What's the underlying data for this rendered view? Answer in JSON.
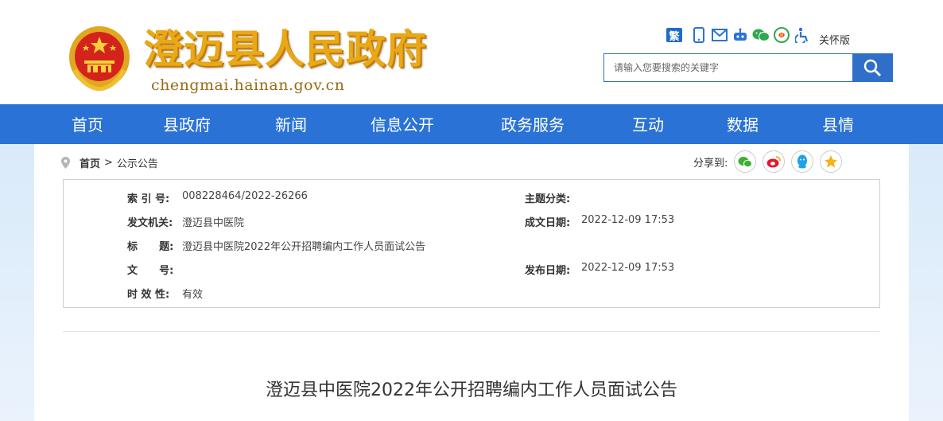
{
  "header": {
    "site_title": "澄迈县人民政府",
    "site_domain": "chengmai.hainan.gov.cn",
    "tools": {
      "traditional_label": "繁",
      "icons": [
        "mobile-icon",
        "mail-icon",
        "robot-icon",
        "wechat-icon",
        "app-icon",
        "accessibility-icon"
      ],
      "care_mode_label": "关怀版"
    },
    "search": {
      "placeholder": "请输入您要搜索的关键字"
    }
  },
  "nav": {
    "items": [
      {
        "label": "首页"
      },
      {
        "label": "县政府"
      },
      {
        "label": "新闻"
      },
      {
        "label": "信息公开"
      },
      {
        "label": "政务服务"
      },
      {
        "label": "互动"
      },
      {
        "label": "数据"
      },
      {
        "label": "县情"
      }
    ]
  },
  "breadcrumb": {
    "home": "首页",
    "separator": ">",
    "current": "公示公告"
  },
  "share": {
    "label": "分享到:",
    "icons": [
      "wechat-icon",
      "weibo-icon",
      "qq-icon",
      "qzone-icon"
    ]
  },
  "meta": {
    "index_label": "索 引 号:",
    "index_value": "008228464/2022-26266",
    "topic_label": "主题分类:",
    "topic_value": "",
    "issuer_label": "发文机关:",
    "issuer_value": "澄迈县中医院",
    "created_label": "成文日期:",
    "created_value": "2022-12-09 17:53",
    "title_label": "标      题:",
    "title_value": "澄迈县中医院2022年公开招聘编内工作人员面试公告",
    "docno_label": "文      号:",
    "docno_value": "",
    "published_label": "发布日期:",
    "published_value": "2022-12-09 17:53",
    "validity_label": "时 效 性:",
    "validity_value": "有效"
  },
  "article": {
    "title": "澄迈县中医院2022年公开招聘编内工作人员面试公告"
  },
  "colors": {
    "nav_blue": "#2a72d6",
    "title_gold": "#e8a818",
    "emblem_red": "#d4231c"
  }
}
